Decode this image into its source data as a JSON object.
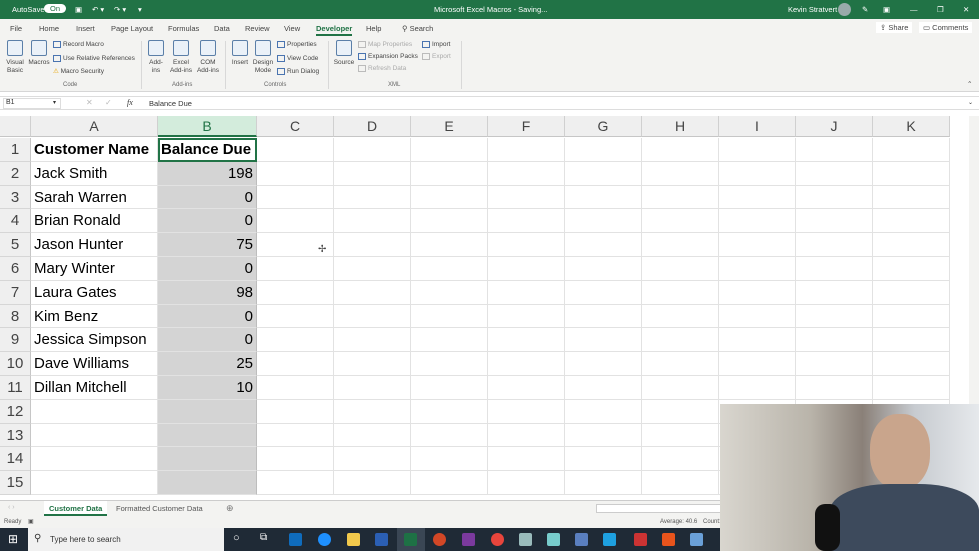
{
  "titlebar": {
    "autosave_label": "AutoSave",
    "autosave_state": "On",
    "title": "Microsoft Excel Macros - Saving...",
    "user": "Kevin Stratvert"
  },
  "tabs": [
    "File",
    "Home",
    "Insert",
    "Page Layout",
    "Formulas",
    "Data",
    "Review",
    "View",
    "Developer",
    "Help"
  ],
  "active_tab": "Developer",
  "search_label": "Search",
  "share_label": "Share",
  "comments_label": "Comments",
  "ribbon": {
    "code": {
      "visual_basic": "Visual Basic",
      "macros": "Macros",
      "record_macro": "Record Macro",
      "relative_refs": "Use Relative References",
      "macro_security": "Macro Security",
      "group": "Code"
    },
    "addins": {
      "addins": "Add-ins",
      "excel_addins": "Excel Add-ins",
      "com_addins": "COM Add-ins",
      "group": "Add-ins"
    },
    "controls": {
      "insert": "Insert",
      "design_mode": "Design Mode",
      "properties": "Properties",
      "view_code": "View Code",
      "run_dialog": "Run Dialog",
      "group": "Controls"
    },
    "xml": {
      "source": "Source",
      "map_properties": "Map Properties",
      "expansion_packs": "Expansion Packs",
      "refresh_data": "Refresh Data",
      "import": "Import",
      "export": "Export",
      "group": "XML"
    }
  },
  "formula_bar": {
    "name_box": "B1",
    "formula": "Balance Due"
  },
  "columns": [
    "A",
    "B",
    "C",
    "D",
    "E",
    "F",
    "G",
    "H",
    "I",
    "J",
    "K"
  ],
  "selected_column": "B",
  "rows": [
    [
      "Customer Name",
      "Balance Due"
    ],
    [
      "Jack Smith",
      "198"
    ],
    [
      "Sarah Warren",
      "0"
    ],
    [
      "Brian Ronald",
      "0"
    ],
    [
      "Jason Hunter",
      "75"
    ],
    [
      "Mary Winter",
      "0"
    ],
    [
      "Laura Gates",
      "98"
    ],
    [
      "Kim Benz",
      "0"
    ],
    [
      "Jessica Simpson",
      "0"
    ],
    [
      "Dave Williams",
      "25"
    ],
    [
      "Dillan Mitchell",
      "10"
    ],
    [
      "",
      ""
    ],
    [
      "",
      ""
    ],
    [
      "",
      ""
    ],
    [
      "",
      ""
    ]
  ],
  "row_numbers": [
    "1",
    "2",
    "3",
    "4",
    "5",
    "6",
    "7",
    "8",
    "9",
    "10",
    "11",
    "12",
    "13",
    "14",
    "15"
  ],
  "sheets": [
    "Customer Data",
    "Formatted Customer Data"
  ],
  "active_sheet": "Customer Data",
  "status": {
    "ready": "Ready",
    "average": "Average: 40.6",
    "count": "Count:"
  },
  "taskbar": {
    "search_placeholder": "Type here to search"
  }
}
